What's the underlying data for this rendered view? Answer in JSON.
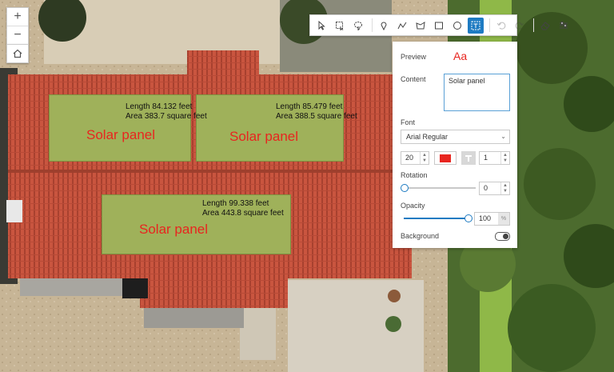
{
  "map": {
    "zoom_in": "+",
    "zoom_out": "−",
    "home_icon": "home-icon",
    "panels": [
      {
        "label": "Solar panel",
        "length": "Length 84.132 feet",
        "area": "Area 383.7 square feet"
      },
      {
        "label": "Solar panel",
        "length": "Length 85.479 feet",
        "area": "Area 388.5 square feet"
      },
      {
        "label": "Solar panel",
        "length": "Length 99.338 feet",
        "area": "Area 443.8 square feet"
      }
    ]
  },
  "toolbar": {
    "tools": [
      "select-icon",
      "rectangle-select-icon",
      "lasso-select-icon",
      "point-icon",
      "polyline-icon",
      "freehand-polygon-icon",
      "rectangle-icon",
      "circle-icon",
      "text-icon",
      "undo-icon",
      "redo-icon",
      "eraser-icon",
      "settings-icon"
    ],
    "active": "text-icon"
  },
  "panel": {
    "preview_label": "Preview",
    "preview_text": "Aa",
    "content_label": "Content",
    "content_value": "Solar panel",
    "font_label": "Font",
    "font_value": "Arial Regular",
    "font_size": "20",
    "text_color": "#e8251f",
    "halo_size": "1",
    "rotation_label": "Rotation",
    "rotation_value": "0",
    "opacity_label": "Opacity",
    "opacity_value": "100",
    "opacity_unit": "%",
    "background_label": "Background",
    "background_on": false
  },
  "colors": {
    "accent": "#1e7bc2",
    "label_red": "#e8251f",
    "panel_green": "#9fb15a",
    "roof": "#c5533d"
  }
}
